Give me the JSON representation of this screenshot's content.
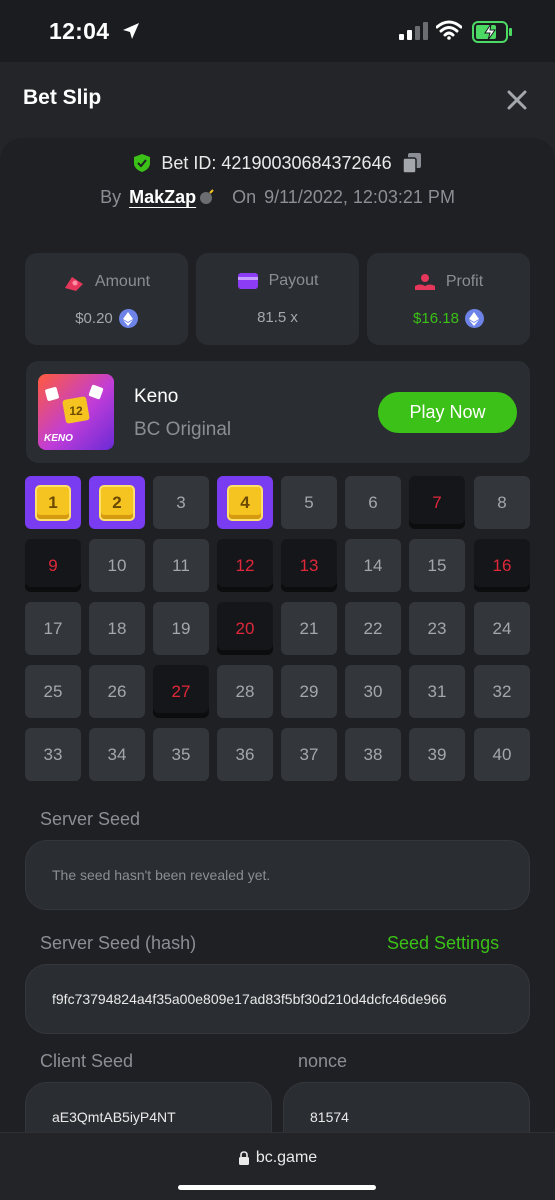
{
  "status_bar": {
    "time": "12:04"
  },
  "header": {
    "title": "Bet Slip",
    "close_icon": "close-icon"
  },
  "bet": {
    "id_label": "Bet ID: 4219003068437264​6",
    "by_label": "By",
    "user": "MakZap",
    "on_label": "On",
    "datetime": "9/11/2022, 12:03:21 PM"
  },
  "stats": [
    {
      "label": "Amount",
      "value": "$0.20",
      "icon": "money-icon",
      "coin": true,
      "value_color": "#a4a7ac"
    },
    {
      "label": "Payout",
      "value": "81.5 x",
      "icon": "card-icon",
      "coin": false,
      "value_color": "#a4a7ac"
    },
    {
      "label": "Profit",
      "value": "$16.18",
      "icon": "profit-icon",
      "coin": true,
      "value_color": "#3bc117"
    }
  ],
  "game": {
    "name": "Keno",
    "subtitle": "BC Original",
    "thumb_label": "KENO",
    "play_label": "Play Now"
  },
  "grid": {
    "numbers": [
      "1",
      "2",
      "3",
      "4",
      "5",
      "6",
      "7",
      "8",
      "9",
      "10",
      "11",
      "12",
      "13",
      "14",
      "15",
      "16",
      "17",
      "18",
      "19",
      "20",
      "21",
      "22",
      "23",
      "24",
      "25",
      "26",
      "27",
      "28",
      "29",
      "30",
      "31",
      "32",
      "33",
      "34",
      "35",
      "36",
      "37",
      "38",
      "39",
      "40"
    ],
    "picked": [
      "1",
      "2",
      "4"
    ],
    "drawn": [
      "7",
      "9",
      "12",
      "13",
      "16",
      "20",
      "27"
    ]
  },
  "seeds": {
    "server_seed_label": "Server Seed",
    "server_seed_value": "The seed hasn't been revealed yet.",
    "server_hash_label": "Server Seed (hash)",
    "seed_settings_label": "Seed Settings",
    "server_hash_value": "f9fc73794824a4f35a00e809e17ad83f5bf30d210d4dcfc46de966",
    "client_seed_label": "Client Seed",
    "client_seed_value": "aE3QmtAB5iyP4NT",
    "nonce_label": "nonce",
    "nonce_value": "81574"
  },
  "browser": {
    "url": "bc.game"
  },
  "colors": {
    "accent_green": "#3bc117",
    "pick_purple": "#7a3cf0",
    "hit_red": "#e0283a"
  }
}
